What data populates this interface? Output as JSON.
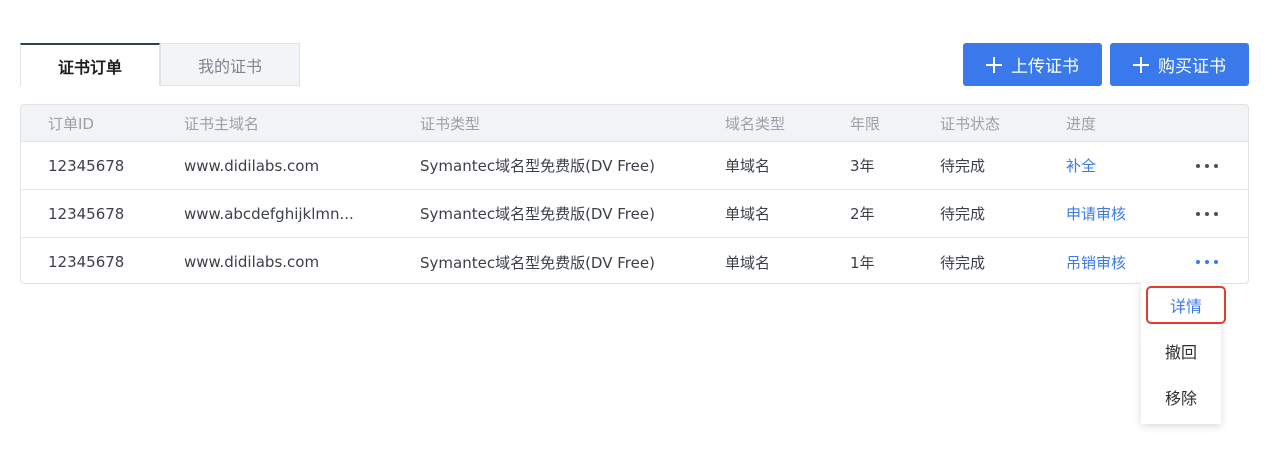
{
  "tabs": [
    {
      "label": "证书订单",
      "active": true
    },
    {
      "label": "我的证书",
      "active": false
    }
  ],
  "actions": {
    "upload_label": "上传证书",
    "buy_label": "购买证书"
  },
  "table": {
    "columns": [
      "订单ID",
      "证书主域名",
      "证书类型",
      "域名类型",
      "年限",
      "证书状态",
      "进度"
    ],
    "rows": [
      {
        "order_id": "12345678",
        "domain": "www.didilabs.com",
        "cert_type": "Symantec域名型免费版(DV Free)",
        "domain_type": "单域名",
        "years": "3年",
        "status": "待完成",
        "progress": "补全"
      },
      {
        "order_id": "12345678",
        "domain": "www.abcdefghijklmn...",
        "cert_type": "Symantec域名型免费版(DV Free)",
        "domain_type": "单域名",
        "years": "2年",
        "status": "待完成",
        "progress": "申请审核"
      },
      {
        "order_id": "12345678",
        "domain": "www.didilabs.com",
        "cert_type": "Symantec域名型免费版(DV Free)",
        "domain_type": "单域名",
        "years": "1年",
        "status": "待完成",
        "progress": "吊销审核"
      }
    ]
  },
  "menu": {
    "items": [
      "详情",
      "撤回",
      "移除"
    ],
    "highlighted": "详情"
  },
  "colors": {
    "accent": "#3a79ec",
    "highlight_border": "#e23b32"
  }
}
